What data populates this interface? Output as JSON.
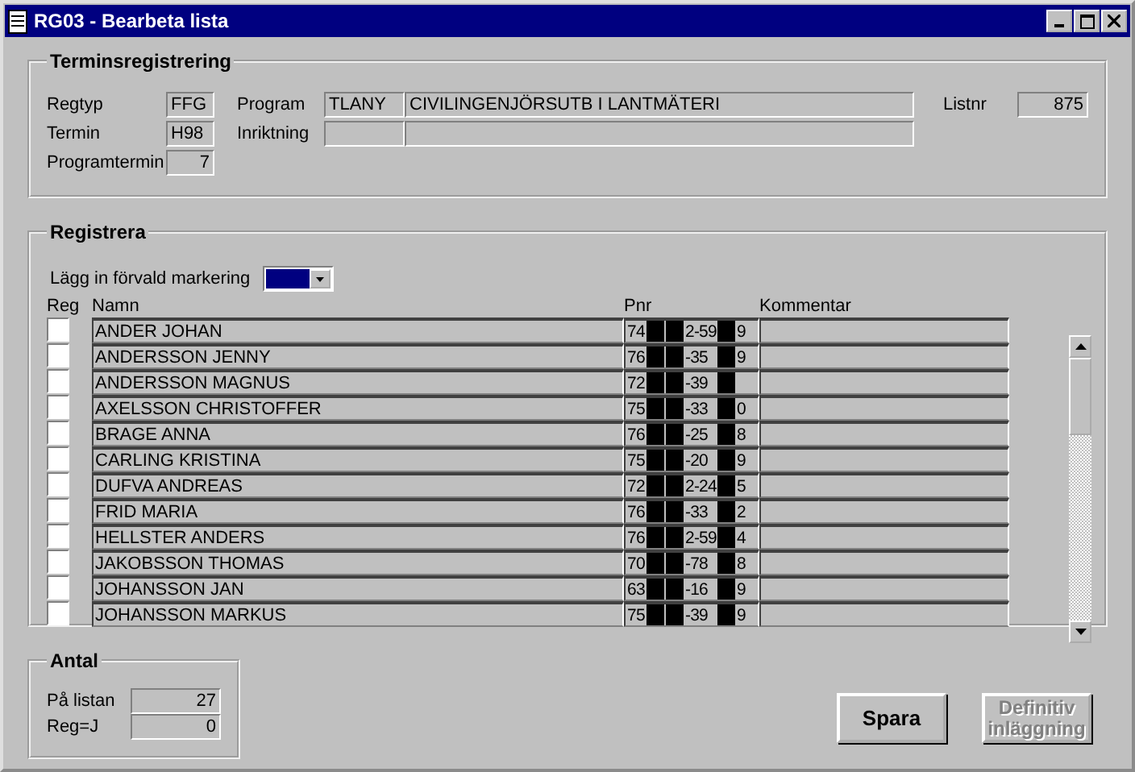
{
  "window": {
    "title": "RG03 - Bearbeta lista"
  },
  "terminsregistrering": {
    "title": "Terminsregistrering",
    "regtyp": {
      "label": "Regtyp",
      "value": "FFG"
    },
    "termin": {
      "label": "Termin",
      "value": "H98"
    },
    "programtermin": {
      "label": "Programtermin",
      "value": "7"
    },
    "program": {
      "label": "Program",
      "code": "TLANY",
      "name": "CIVILINGENJÖRSUTB I LANTMÄTERI"
    },
    "inriktning": {
      "label": "Inriktning"
    },
    "listnr": {
      "label": "Listnr",
      "value": "875"
    }
  },
  "registrera": {
    "title": "Registrera",
    "default_marking": {
      "label": "Lägg in förvald markering",
      "color": "#000080"
    },
    "columns": [
      "Reg",
      "Namn",
      "Pnr",
      "Kommentar"
    ],
    "rows": [
      {
        "reg": false,
        "name": "ANDER JOHAN",
        "pnr": [
          "74",
          "2-59",
          "9"
        ]
      },
      {
        "reg": false,
        "name": "ANDERSSON JENNY",
        "pnr": [
          "76",
          "-35",
          "9"
        ]
      },
      {
        "reg": false,
        "name": "ANDERSSON MAGNUS",
        "pnr": [
          "72",
          "-39"
        ]
      },
      {
        "reg": false,
        "name": "AXELSSON CHRISTOFFER",
        "pnr": [
          "75",
          "-33",
          "0"
        ]
      },
      {
        "reg": false,
        "name": "BRAGE ANNA",
        "pnr": [
          "76",
          "-25",
          "8"
        ]
      },
      {
        "reg": false,
        "name": "CARLING KRISTINA",
        "pnr": [
          "75",
          "-20",
          "9"
        ]
      },
      {
        "reg": false,
        "name": "DUFVA ANDREAS",
        "pnr": [
          "72",
          "2-24",
          "5"
        ]
      },
      {
        "reg": false,
        "name": "FRID MARIA",
        "pnr": [
          "76",
          "-33",
          "2"
        ]
      },
      {
        "reg": false,
        "name": "HELLSTER ANDERS",
        "pnr": [
          "76",
          "2-59",
          "4"
        ]
      },
      {
        "reg": false,
        "name": "JAKOBSSON THOMAS",
        "pnr": [
          "70",
          "-78",
          "8"
        ]
      },
      {
        "reg": false,
        "name": "JOHANSSON JAN",
        "pnr": [
          "63",
          "-16",
          "9"
        ]
      },
      {
        "reg": false,
        "name": "JOHANSSON MARKUS",
        "pnr": [
          "75",
          "-39",
          "9"
        ]
      }
    ]
  },
  "antal": {
    "title": "Antal",
    "pa_listan": {
      "label": "På listan",
      "value": "27"
    },
    "reg_j": {
      "label": "Reg=J",
      "value": "0"
    }
  },
  "buttons": [
    {
      "label": "Spara",
      "disabled": false
    },
    {
      "label": "Definitiv inläggning",
      "disabled": true
    }
  ]
}
